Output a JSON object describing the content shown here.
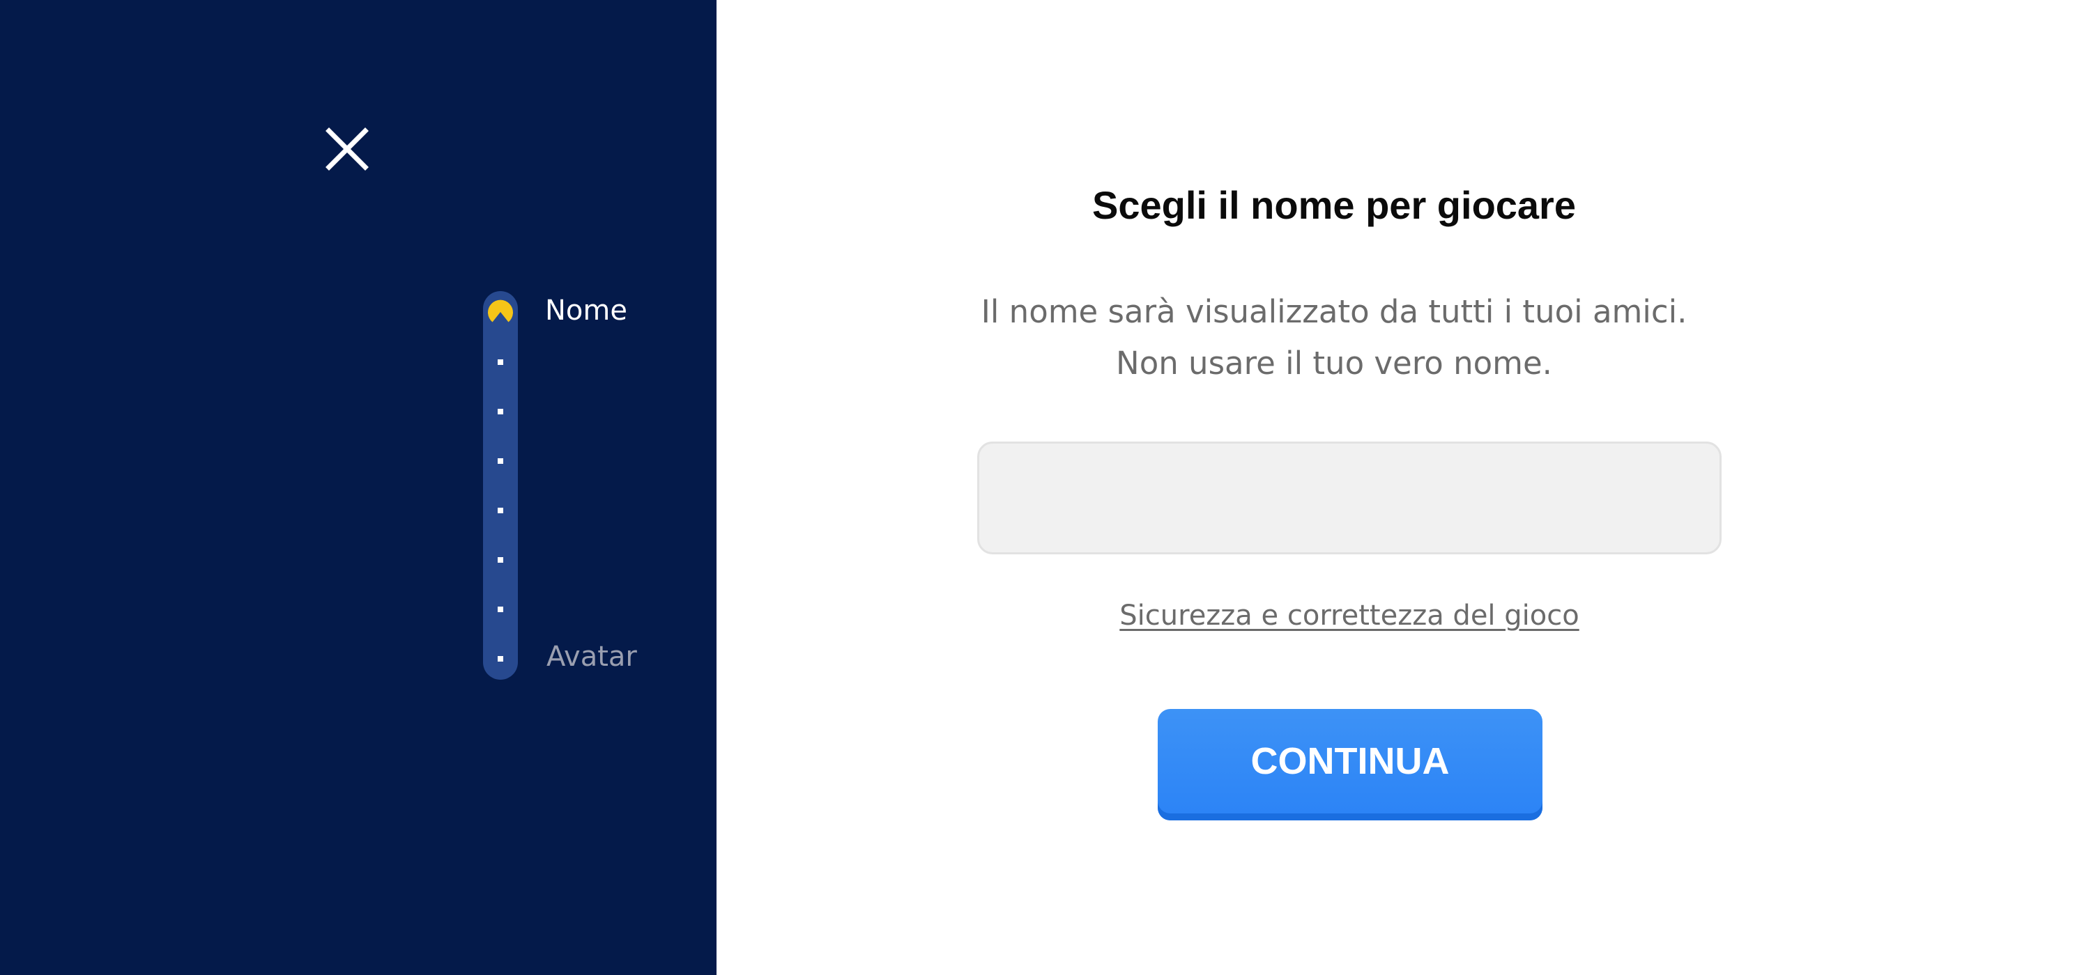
{
  "sidebar": {
    "close_icon": "close-icon",
    "steps": [
      {
        "label": "Nome",
        "state": "current",
        "icon": "pacman-icon"
      },
      {
        "label": "Avatar",
        "state": "upcoming"
      }
    ],
    "colors": {
      "panel_bg": "#041a4a",
      "track": "#27498f",
      "current_step": "#f5c518"
    }
  },
  "main": {
    "title": "Scegli il nome per giocare",
    "subtitle_line1": "Il nome sarà visualizzato da tutti i tuoi amici.",
    "subtitle_line2": "Non usare il tuo vero nome.",
    "name_input": {
      "value": "",
      "placeholder": ""
    },
    "safety_link": "Sicurezza e correttezza del gioco",
    "continue_label": "CONTINUA",
    "colors": {
      "button": "#2b83f6",
      "text_muted": "#6b6b6b"
    }
  }
}
